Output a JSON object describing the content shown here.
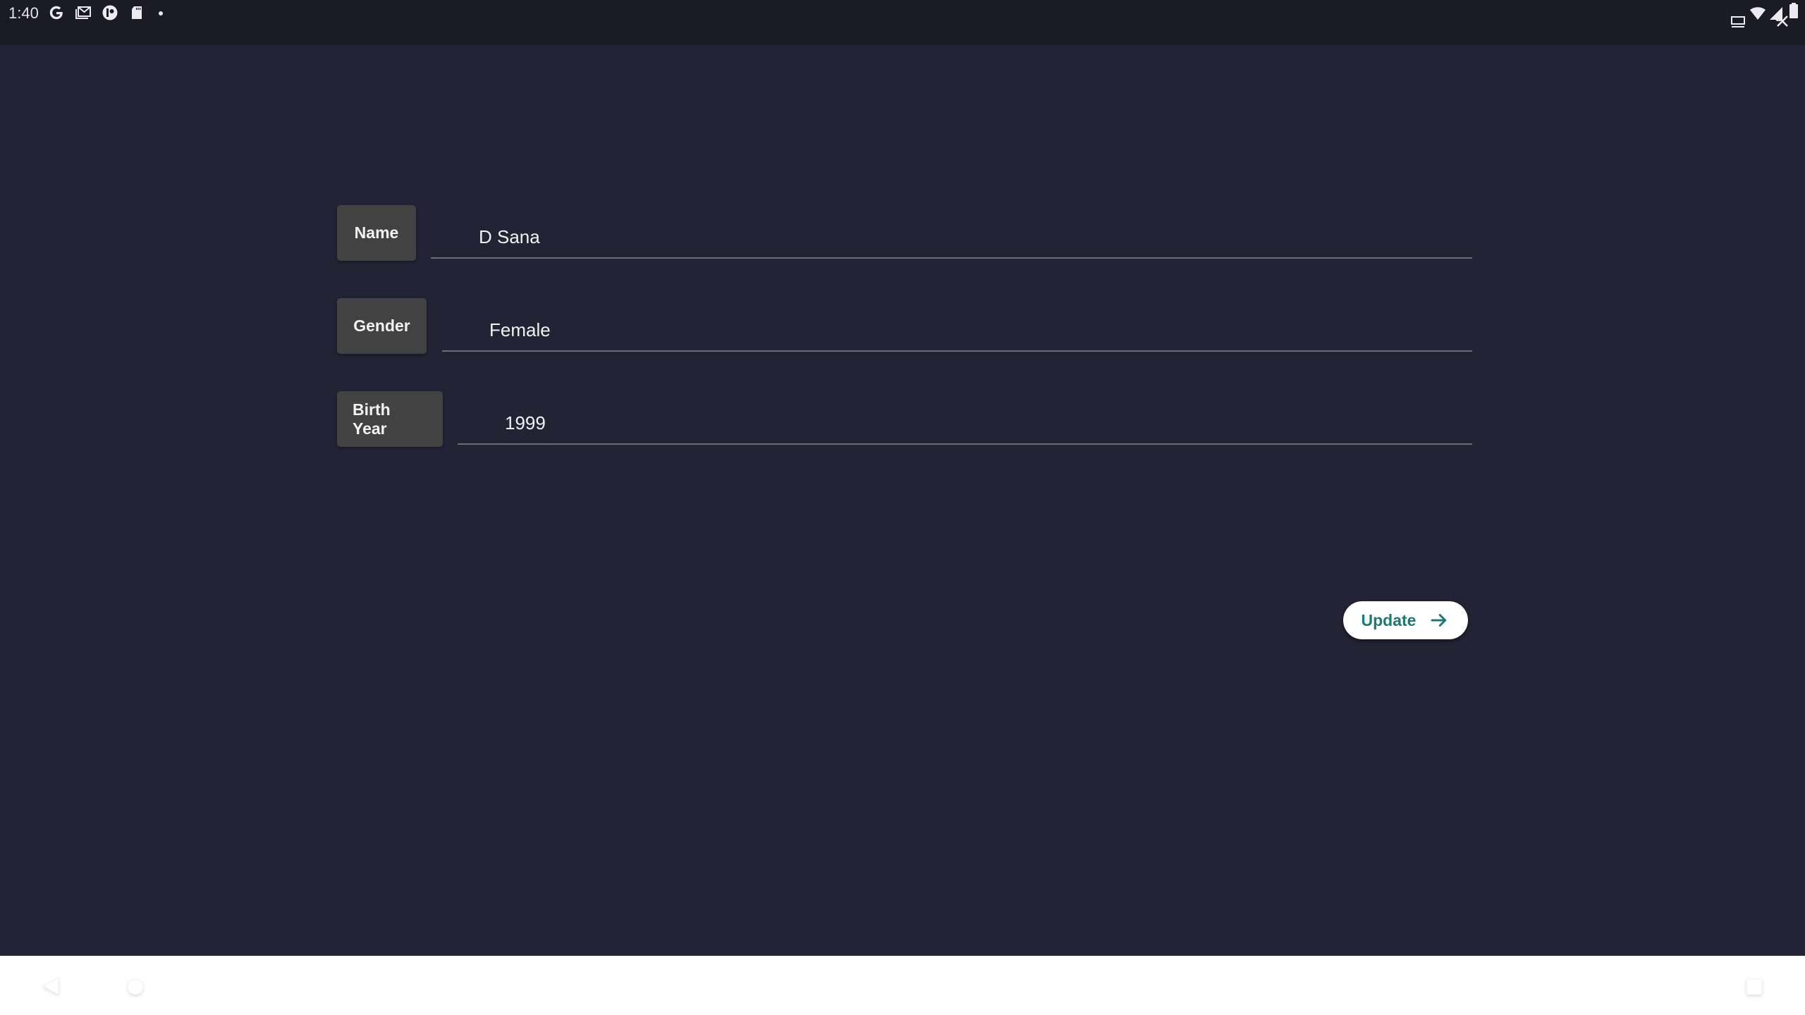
{
  "status_bar": {
    "time": "1:40",
    "left_icons": [
      "google-icon",
      "gmail-icon",
      "app-icon",
      "sd-card-icon",
      "notification-dot"
    ],
    "right_icons": [
      "cast-icon",
      "wifi-icon",
      "signal-icon",
      "battery-icon"
    ]
  },
  "form": {
    "fields": [
      {
        "label": "Name",
        "value": "D Sana"
      },
      {
        "label": "Gender",
        "value": "Female"
      },
      {
        "label": "Birth Year",
        "value": "1999"
      }
    ],
    "submit_label": "Update",
    "submit_icon": "arrow-right-icon"
  },
  "nav_bar": {
    "buttons": [
      "back",
      "home",
      "recents"
    ]
  },
  "colors": {
    "background": "#222334",
    "status_bar": "#1b1b25",
    "label_box": "#424242",
    "accent": "#1d7a74",
    "underline": "#6b6c78"
  }
}
